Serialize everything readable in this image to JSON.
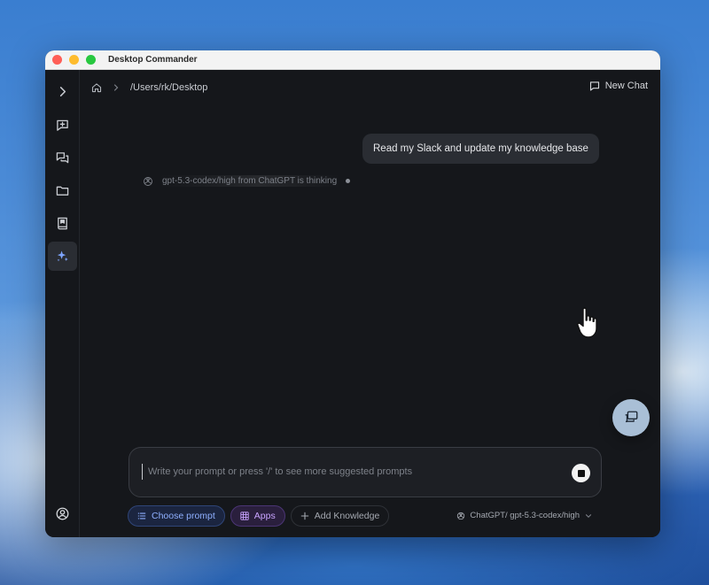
{
  "window": {
    "title": "Desktop Commander"
  },
  "header": {
    "path": "/Users/rk/Desktop",
    "new_chat_label": "New Chat"
  },
  "sidebar": {
    "items": [
      {
        "name": "expand",
        "icon": "chevron-right-icon"
      },
      {
        "name": "new-chat",
        "icon": "chat-plus-icon"
      },
      {
        "name": "chats",
        "icon": "chats-icon"
      },
      {
        "name": "files",
        "icon": "folder-icon"
      },
      {
        "name": "knowledge",
        "icon": "book-icon"
      },
      {
        "name": "ai",
        "icon": "sparkles-icon",
        "active": true
      },
      {
        "name": "account",
        "icon": "user-circle-icon"
      }
    ]
  },
  "chat": {
    "user_message": "Read my Slack and update my knowledge base",
    "thinking_text": "gpt-5.3-codex/high from ChatGPT is thinking"
  },
  "input": {
    "placeholder": "Write your prompt or press '/' to see more suggested prompts",
    "value": ""
  },
  "toolbar": {
    "choose_prompt_label": "Choose prompt",
    "apps_label": "Apps",
    "add_knowledge_label": "Add Knowledge",
    "model_label": "ChatGPT/ gpt-5.3-codex/high"
  },
  "colors": {
    "accent_blue": "#8fb0ff",
    "accent_purple": "#c9a4ff",
    "panel": "#15171b",
    "bubble": "#2a2d33"
  }
}
